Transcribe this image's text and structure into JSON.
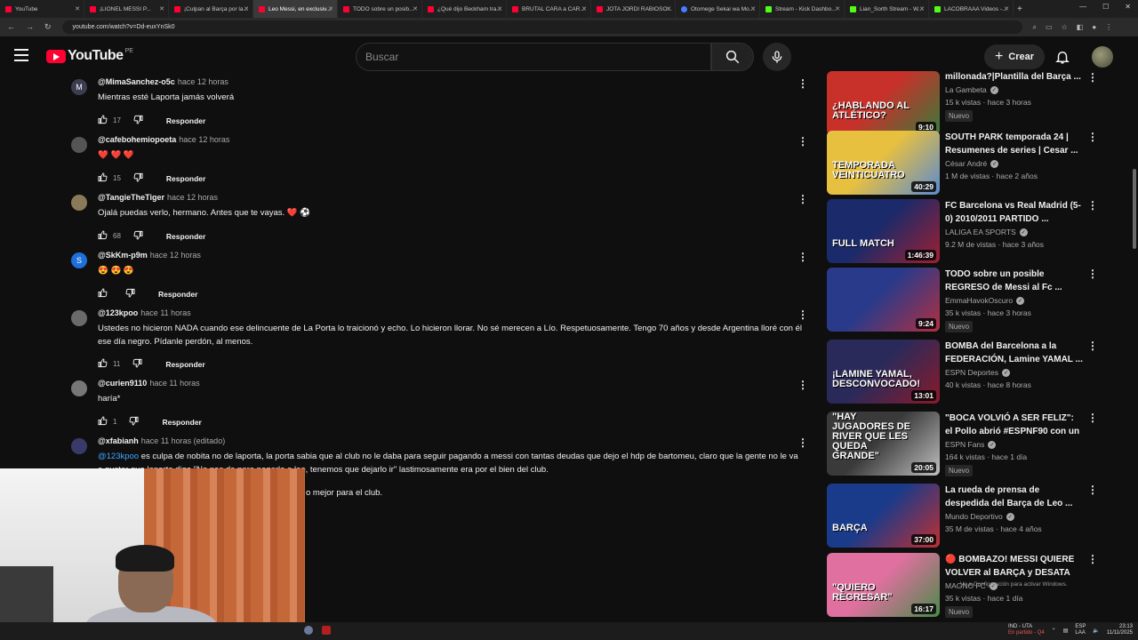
{
  "browser": {
    "tabs": [
      {
        "label": "YouTube",
        "fav": "r",
        "active": false
      },
      {
        "label": "¡LIONEL MESSI P...",
        "fav": "r",
        "active": false
      },
      {
        "label": "¡Culpan al Barça por la...",
        "fav": "r",
        "active": false
      },
      {
        "label": "Leo Messi, en exclusiv...",
        "fav": "r",
        "active": true
      },
      {
        "label": "TODO sobre un posib...",
        "fav": "r",
        "active": false
      },
      {
        "label": "¿Qué dijo Beckham tra...",
        "fav": "r",
        "active": false
      },
      {
        "label": "BRUTAL CARA a CAR...",
        "fav": "r",
        "active": false
      },
      {
        "label": "JOTA JORDI RABIOSO...",
        "fav": "r",
        "active": false
      },
      {
        "label": "Otomege Sekai wa Mo...",
        "fav": "b",
        "active": false
      },
      {
        "label": "Stream - Kick Dashbo...",
        "fav": "g",
        "active": false
      },
      {
        "label": "Lian_Sorth Stream - W...",
        "fav": "g",
        "active": false
      },
      {
        "label": "LACOBRAAA Videos -...",
        "fav": "g",
        "active": false
      }
    ],
    "url": "youtube.com/watch?v=Dd-euxYnSk0"
  },
  "header": {
    "logo_text": "YouTube",
    "country": "PE",
    "search_placeholder": "Buscar",
    "create_label": "Crear"
  },
  "comments": [
    {
      "user": "@MimaSanchez-o5c",
      "time": "hace 12 horas",
      "text": "Mientras esté Laporta jamás volverá",
      "likes": "17",
      "avatar_letter": "M",
      "avatar_color": "#3d3d52"
    },
    {
      "user": "@cafebohemiopoeta",
      "time": "hace 12 horas",
      "text": "❤️ ❤️ ❤️",
      "likes": "15",
      "avatar_letter": "",
      "avatar_color": "#555555"
    },
    {
      "user": "@TangieTheTiger",
      "time": "hace 12 horas",
      "text": "Ojalá puedas verlo, hermano. Antes que te vayas. ❤️ ⚽",
      "likes": "68",
      "avatar_letter": "",
      "avatar_color": "#8a7a5a"
    },
    {
      "user": "@SkKm-p9m",
      "time": "hace 12 horas",
      "text": "😍 😍 😍",
      "likes": "",
      "avatar_letter": "S",
      "avatar_color": "#1e6fd9"
    },
    {
      "user": "@123kpoo",
      "time": "hace 11 horas",
      "text": "Ustedes no hicieron NADA cuando ese delincuente de La Porta lo traicionó y echo. Lo hicieron llorar. No sé merecen  a Lío. Respetuosamente. Tengo 70 años y desde Argentina lloré con él ese día negro. Pídanle perdón, al menos.",
      "likes": "11",
      "avatar_letter": "",
      "avatar_color": "#6a6a6a"
    },
    {
      "user": "@curien9110",
      "time": "hace 11 horas",
      "text": "haría*",
      "likes": "1",
      "avatar_letter": "",
      "avatar_color": "#777777"
    },
    {
      "user": "@xfabianh",
      "time": "hace 11 horas (editado)",
      "mention": "@123kpoo",
      "text": "es culpa de nobita no de laporta, la porta sabia que al club no le daba para seguir pagando a messi con tantas deudas que dejo el hdp de bartomeu, claro que la gente no le va a gustar que laporta diga \"No nos da para pagarle a leo, tenemos que dejarlo ir\" lastimosamente era por el bien del club.",
      "likes": "",
      "avatar_letter": "",
      "avatar_color": "#3a3a6a"
    }
  ],
  "comment_partial": "o mejor para el club.",
  "reply_label": "Responder",
  "sidebar": [
    {
      "title": "millonada?|Plantilla del Barça ...",
      "channel": "La Gambeta",
      "meta": "15 k vistas · hace 3 horas",
      "duration": "9:10",
      "new": "Nuevo",
      "thumb_a": "#c8302a",
      "thumb_b": "#3a7a3a",
      "overlay": "¿HABLANDO AL ATLÉTICO?"
    },
    {
      "title": "SOUTH PARK temporada 24 | Resumenes de series | Cesar ...",
      "channel": "César André",
      "meta": "1 M de vistas · hace 2 años",
      "duration": "40:29",
      "new": "",
      "thumb_a": "#e8c040",
      "thumb_b": "#5a8ad0",
      "overlay": "TEMPORADA VEINTICUATRO"
    },
    {
      "title": "FC Barcelona vs Real Madrid (5-0) 2010/2011 PARTIDO ...",
      "channel": "LALIGA EA SPORTS",
      "meta": "9.2 M de vistas · hace 3 años",
      "duration": "1:46:39",
      "new": "",
      "thumb_a": "#1a2a6a",
      "thumb_b": "#a02030",
      "overlay": "FULL MATCH"
    },
    {
      "title": "TODO sobre un posible REGRESO de Messi al Fc ...",
      "channel": "EmmaHavokOscuro",
      "meta": "35 k vistas · hace 3 horas",
      "duration": "9:24",
      "new": "Nuevo",
      "thumb_a": "#2a3a8a",
      "thumb_b": "#b03040",
      "overlay": ""
    },
    {
      "title": "BOMBA del Barcelona a la FEDERACIÓN, Lamine YAMAL ...",
      "channel": "ESPN Deportes",
      "meta": "40 k vistas · hace 8 horas",
      "duration": "13:01",
      "new": "",
      "thumb_a": "#2a2a5a",
      "thumb_b": "#8a1a2a",
      "overlay": "¡LAMINE YAMAL, DESCONVOCADO!"
    },
    {
      "title": "\"BOCA VOLVIÓ A SER FELIZ\": el Pollo abrió #ESPNF90 con un ...",
      "channel": "ESPN Fans",
      "meta": "164 k vistas · hace 1 día",
      "duration": "20:05",
      "new": "Nuevo",
      "thumb_a": "#3a3a3a",
      "thumb_b": "#c0c0c0",
      "overlay": "\"HAY JUGADORES DE RIVER QUE LES QUEDA GRANDE\""
    },
    {
      "title": "La rueda de prensa de despedida del Barça de Leo ...",
      "channel": "Mundo Deportivo",
      "meta": "35 M de vistas · hace 4 años",
      "duration": "37:00",
      "new": "",
      "thumb_a": "#1a3a8a",
      "thumb_b": "#c03030",
      "overlay": "BARÇA"
    },
    {
      "title": "BOMBAZO! MESSI QUIERE VOLVER al BARÇA y DESATA L...",
      "channel": "MAGNO FC",
      "meta": "35 k vistas · hace 1 día",
      "duration": "16:17",
      "new": "Nuevo",
      "thumb_a": "#e070a0",
      "thumb_b": "#4a8a4a",
      "overlay": "\"QUIERO REGRESAR\""
    }
  ],
  "bombazo_emoji": "🔴",
  "activate_windows": "Ve a Configuración para activar Windows.",
  "taskbar": {
    "match_title": "IND - UTA",
    "match_sub": "En partido - Q4",
    "lang": "ESP",
    "lang_sub": "LAA",
    "time": "23:13",
    "date": "11/11/2025"
  }
}
